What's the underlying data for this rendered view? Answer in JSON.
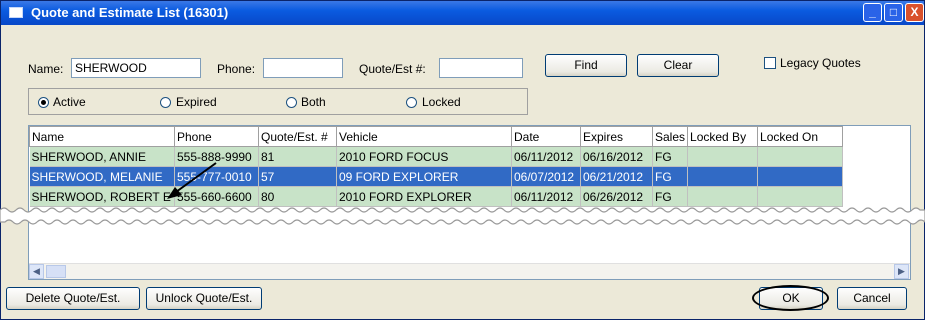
{
  "window": {
    "title": "Quote and Estimate List (16301)",
    "controls": {
      "minimize": "_",
      "maximize": "□",
      "close": "X"
    }
  },
  "search": {
    "name_label": "Name:",
    "name_value": "SHERWOOD",
    "phone_label": "Phone:",
    "phone_value": "",
    "quote_label": "Quote/Est #:",
    "quote_value": "",
    "find_label": "Find",
    "clear_label": "Clear",
    "legacy_label": "Legacy Quotes",
    "legacy_checked": false
  },
  "filter": {
    "options": [
      {
        "label": "Active",
        "selected": true
      },
      {
        "label": "Expired",
        "selected": false
      },
      {
        "label": "Both",
        "selected": false
      },
      {
        "label": "Locked",
        "selected": false
      }
    ]
  },
  "grid": {
    "columns": [
      "Name",
      "Phone",
      "Quote/Est. #",
      "Vehicle",
      "Date",
      "Expires",
      "Sales",
      "Locked By",
      "Locked On"
    ],
    "rows": [
      [
        "SHERWOOD, ANNIE",
        "555-888-9990",
        "81",
        "2010 FORD FOCUS",
        "06/11/2012",
        "06/16/2012",
        "FG",
        "",
        ""
      ],
      [
        "SHERWOOD, MELANIE",
        "555-777-0010",
        "57",
        "09 FORD EXPLORER",
        "06/07/2012",
        "06/21/2012",
        "FG",
        "",
        ""
      ],
      [
        "SHERWOOD, ROBERT E",
        "555-660-6600",
        "80",
        "2010 FORD EXPLORER",
        "06/11/2012",
        "06/26/2012",
        "FG",
        "",
        ""
      ]
    ],
    "selected_row": 1,
    "row_color": "#c8e3c8",
    "selected_color": "#316ac5"
  },
  "footer": {
    "delete_label": "Delete Quote/Est.",
    "unlock_label": "Unlock Quote/Est.",
    "ok_label": "OK",
    "cancel_label": "Cancel"
  },
  "icons": {
    "window_icon": "window-icon",
    "arrow": "annotation-arrow-icon",
    "scroll_left": "◀",
    "scroll_right": "▶"
  }
}
